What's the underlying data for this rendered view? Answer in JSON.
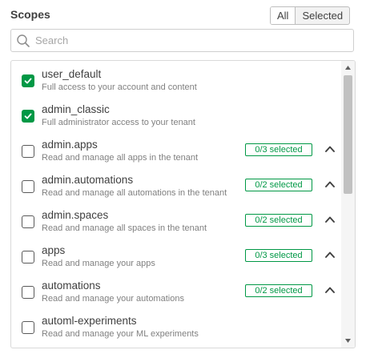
{
  "header": {
    "title": "Scopes",
    "toggle": {
      "all_label": "All",
      "selected_label": "Selected",
      "active": "All"
    }
  },
  "search": {
    "placeholder": "Search",
    "value": ""
  },
  "colors": {
    "accent": "#009845",
    "text": "#404040",
    "muted": "#808080"
  },
  "scopes": [
    {
      "name": "user_default",
      "description": "Full access to your account and content",
      "checked": true,
      "badge": null,
      "expandable": false
    },
    {
      "name": "admin_classic",
      "description": "Full administrator access to your tenant",
      "checked": true,
      "badge": null,
      "expandable": false
    },
    {
      "name": "admin.apps",
      "description": "Read and manage all apps in the tenant",
      "checked": false,
      "badge": "0/3 selected",
      "expandable": true
    },
    {
      "name": "admin.automations",
      "description": "Read and manage all automations in the tenant",
      "checked": false,
      "badge": "0/2 selected",
      "expandable": true
    },
    {
      "name": "admin.spaces",
      "description": "Read and manage all spaces in the tenant",
      "checked": false,
      "badge": "0/2 selected",
      "expandable": true
    },
    {
      "name": "apps",
      "description": "Read and manage your apps",
      "checked": false,
      "badge": "0/3 selected",
      "expandable": true
    },
    {
      "name": "automations",
      "description": "Read and manage your automations",
      "checked": false,
      "badge": "0/2 selected",
      "expandable": true
    },
    {
      "name": "automl-experiments",
      "description": "Read and manage your ML experiments",
      "checked": false,
      "badge": null,
      "expandable": false
    }
  ]
}
